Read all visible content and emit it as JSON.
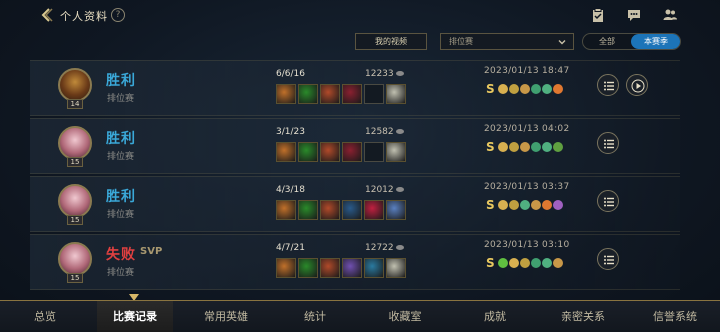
{
  "header": {
    "title": "个人资料",
    "help": "?"
  },
  "filters": {
    "my_videos": "我的视频",
    "mode_select": "排位赛",
    "segments": [
      "全部",
      "本赛季"
    ],
    "selected_segment": "本赛季"
  },
  "matches": [
    {
      "result": "胜利",
      "svp": "",
      "mode": "排位赛",
      "level": "14",
      "kda": "6/6/16",
      "gold": "12233",
      "date": "2023/01/13 18:47",
      "has_replay": true,
      "avatar": "male",
      "items": [
        "#c0702a",
        "#2a8a2a",
        "#b04a2a",
        "#8a2030",
        "empty",
        "#c0c0b0"
      ],
      "runes": [
        "#d8b050",
        "#c0a040",
        "#c89848",
        "#40a070",
        "#50b080",
        "#e07830"
      ]
    },
    {
      "result": "胜利",
      "svp": "",
      "mode": "排位赛",
      "level": "15",
      "kda": "3/1/23",
      "gold": "12582",
      "date": "2023/01/13 04:02",
      "has_replay": false,
      "avatar": "female",
      "items": [
        "#c0702a",
        "#2a8a2a",
        "#b04a2a",
        "#8a2030",
        "empty",
        "#c0c0b0"
      ],
      "runes": [
        "#d8b050",
        "#c0a040",
        "#c89848",
        "#40a070",
        "#50b080",
        "#60a040"
      ]
    },
    {
      "result": "胜利",
      "svp": "",
      "mode": "排位赛",
      "level": "15",
      "kda": "4/3/18",
      "gold": "12012",
      "date": "2023/01/13 03:37",
      "has_replay": false,
      "avatar": "female",
      "items": [
        "#c0702a",
        "#2a8a2a",
        "#b04a2a",
        "#2a5a8a",
        "#c02040",
        "#5a80c0"
      ],
      "runes": [
        "#d8b050",
        "#c0a040",
        "#50b080",
        "#c89848",
        "#e07830",
        "#a060c0"
      ]
    },
    {
      "result": "失败",
      "svp": "SVP",
      "mode": "排位赛",
      "level": "15",
      "kda": "4/7/21",
      "gold": "12722",
      "date": "2023/01/13 03:10",
      "has_replay": false,
      "avatar": "female",
      "items": [
        "#c0702a",
        "#2a8a2a",
        "#b04a2a",
        "#7050b0",
        "#2a7aa0",
        "#c0c0b0"
      ],
      "runes": [
        "#60c040",
        "#d8b050",
        "#c0a040",
        "#40a070",
        "#50b080",
        "#c89848"
      ]
    }
  ],
  "tabs": [
    "总览",
    "比赛记录",
    "常用英雄",
    "统计",
    "收藏室",
    "成就",
    "亲密关系",
    "信誉系统"
  ],
  "active_tab": "比赛记录",
  "colors": {
    "win": "#3aa8d8",
    "lose": "#e04040",
    "accent": "#1c74b8",
    "gold_border": "#8a7440"
  }
}
